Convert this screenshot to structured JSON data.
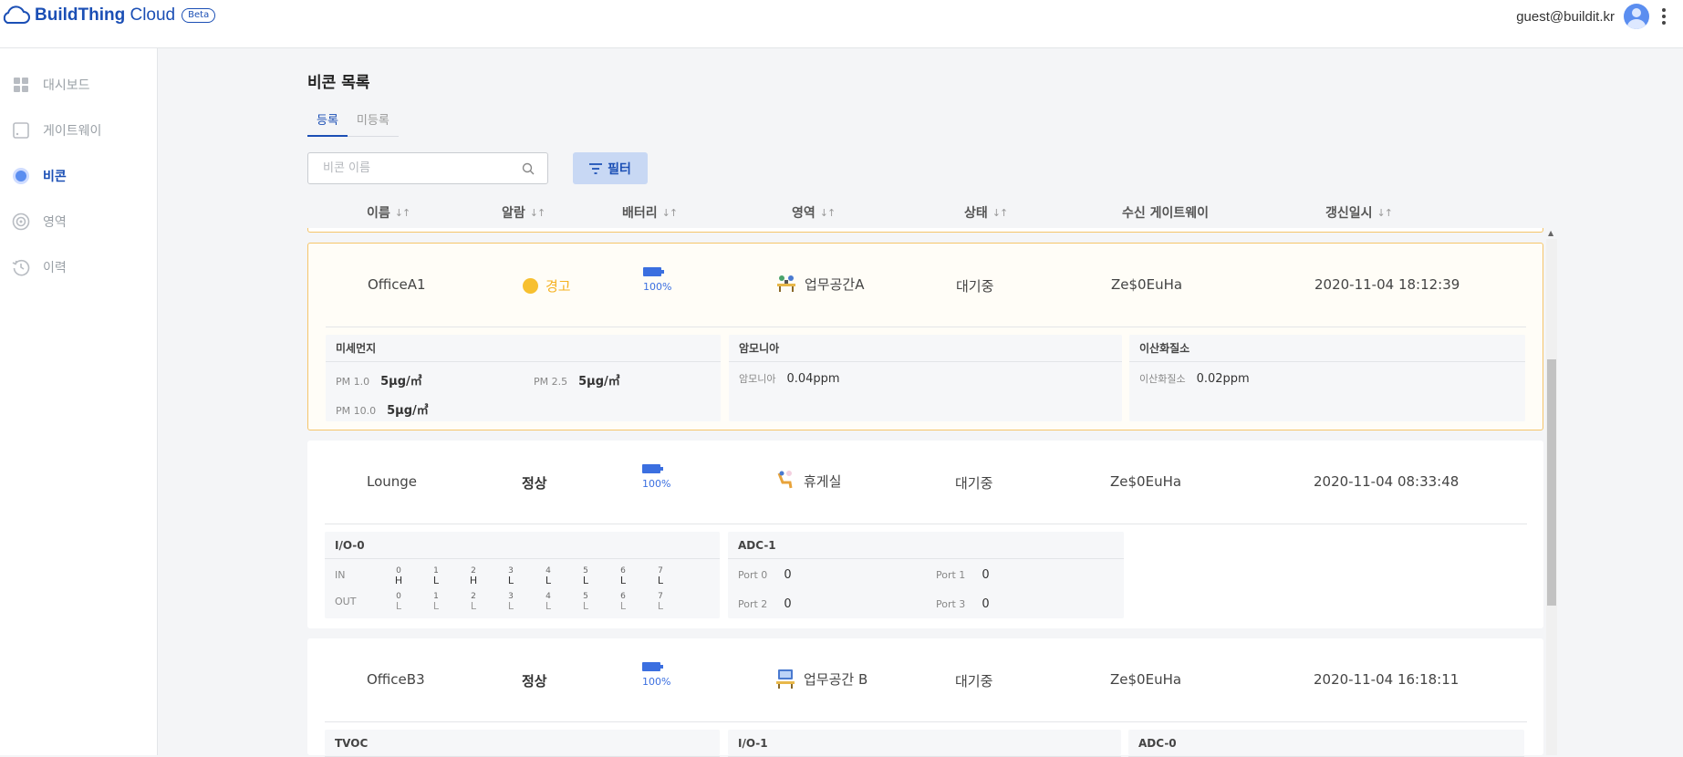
{
  "app": {
    "brand_bold": "BuildThing",
    "brand_rest": "Cloud",
    "badge": "Beta",
    "user_email": "guest@buildit.kr"
  },
  "sidebar": {
    "items": [
      {
        "label": "대시보드",
        "icon": "dashboard-icon",
        "active": false
      },
      {
        "label": "게이트웨이",
        "icon": "gateway-icon",
        "active": false
      },
      {
        "label": "비콘",
        "icon": "beacon-icon",
        "active": true
      },
      {
        "label": "영역",
        "icon": "area-icon",
        "active": false
      },
      {
        "label": "이력",
        "icon": "history-icon",
        "active": false
      }
    ]
  },
  "page": {
    "title": "비콘 목록",
    "tabs": [
      "등록",
      "미등록"
    ],
    "active_tab": 0
  },
  "search": {
    "placeholder": "비콘 이름",
    "value": ""
  },
  "filter": {
    "label": "필터"
  },
  "table": {
    "sort_glyph": "↓↑",
    "columns": [
      "이름",
      "알람",
      "배터리",
      "영역",
      "상태",
      "수신 게이트웨이",
      "갱신일시"
    ],
    "rows": [
      {
        "name": "OfficeA1",
        "alarm": "경고",
        "alarm_level": "warning",
        "battery": "100%",
        "area": "업무공간A",
        "status": "대기중",
        "gateway": "Ze$0EuHa",
        "updated": "2020-11-04 18:12:39",
        "panels": {
          "pm": {
            "title": "미세먼지",
            "items": [
              {
                "key": "PM 1.0",
                "value": "5μg/㎥"
              },
              {
                "key": "PM 2.5",
                "value": "5μg/㎥"
              },
              {
                "key": "PM 10.0",
                "value": "5μg/㎥"
              }
            ]
          },
          "nh3": {
            "title": "암모니아",
            "key": "암모니아",
            "value": "0.04ppm"
          },
          "no2": {
            "title": "이산화질소",
            "key": "이산화질소",
            "value": "0.02ppm"
          }
        }
      },
      {
        "name": "Lounge",
        "alarm": "정상",
        "alarm_level": "normal",
        "battery": "100%",
        "area": "휴게실",
        "status": "대기중",
        "gateway": "Ze$0EuHa",
        "updated": "2020-11-04 08:33:48",
        "panels": {
          "io": {
            "title": "I/O-0",
            "in_label": "IN",
            "out_label": "OUT",
            "bits": [
              "0",
              "1",
              "2",
              "3",
              "4",
              "5",
              "6",
              "7"
            ],
            "in": [
              "H",
              "L",
              "H",
              "L",
              "L",
              "L",
              "L",
              "L"
            ],
            "out": [
              "L",
              "L",
              "L",
              "L",
              "L",
              "L",
              "L",
              "L"
            ]
          },
          "adc": {
            "title": "ADC-1",
            "items": [
              {
                "key": "Port 0",
                "value": "0"
              },
              {
                "key": "Port 1",
                "value": "0"
              },
              {
                "key": "Port 2",
                "value": "0"
              },
              {
                "key": "Port 3",
                "value": "0"
              }
            ]
          }
        }
      },
      {
        "name": "OfficeB3",
        "alarm": "정상",
        "alarm_level": "normal",
        "battery": "100%",
        "area": "업무공간 B",
        "status": "대기중",
        "gateway": "Ze$0EuHa",
        "updated": "2020-11-04 16:18:11",
        "panels": {
          "p1": {
            "title": "TVOC"
          },
          "p2": {
            "title": "I/O-1"
          },
          "p3": {
            "title": "ADC-0"
          }
        }
      }
    ]
  },
  "colors": {
    "brand": "#1b4fb5",
    "warning": "#f5b120",
    "battery": "#3b6fe0",
    "alarm_border": "#f5c56a"
  }
}
